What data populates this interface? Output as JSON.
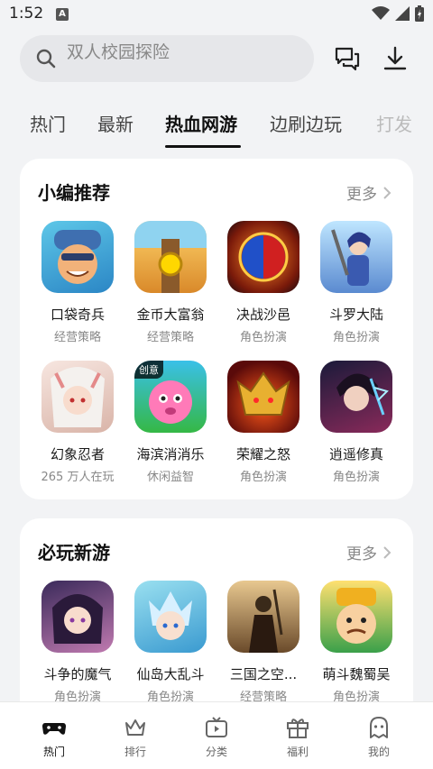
{
  "status_bar": {
    "time": "1:52",
    "badge": "A"
  },
  "search": {
    "placeholder": "双人校园探险"
  },
  "tabs": [
    {
      "label": "热门"
    },
    {
      "label": "最新"
    },
    {
      "label": "热血网游"
    },
    {
      "label": "边刷边玩"
    },
    {
      "label": "打发"
    }
  ],
  "sections": [
    {
      "title": "小编推荐",
      "more": "更多",
      "games": [
        {
          "name": "口袋奇兵",
          "sub": "经营策略"
        },
        {
          "name": "金币大富翁",
          "sub": "经营策略"
        },
        {
          "name": "决战沙邑",
          "sub": "角色扮演"
        },
        {
          "name": "斗罗大陆",
          "sub": "角色扮演"
        },
        {
          "name": "幻象忍者",
          "sub": "265 万人在玩"
        },
        {
          "name": "海滨消消乐",
          "sub": "休闲益智",
          "badge": "创意"
        },
        {
          "name": "荣耀之怒",
          "sub": "角色扮演"
        },
        {
          "name": "逍遥修真",
          "sub": "角色扮演"
        }
      ]
    },
    {
      "title": "必玩新游",
      "more": "更多",
      "games": [
        {
          "name": "斗争的魔气",
          "sub": "角色扮演"
        },
        {
          "name": "仙岛大乱斗",
          "sub": "角色扮演"
        },
        {
          "name": "三国之空...",
          "sub": "经营策略"
        },
        {
          "name": "萌斗魏蜀吴",
          "sub": "角色扮演"
        }
      ]
    }
  ],
  "bottom_nav": [
    {
      "label": "热门",
      "icon": "gamepad-icon"
    },
    {
      "label": "排行",
      "icon": "crown-icon"
    },
    {
      "label": "分类",
      "icon": "tv-icon"
    },
    {
      "label": "福利",
      "icon": "gift-icon"
    },
    {
      "label": "我的",
      "icon": "ghost-icon"
    }
  ]
}
